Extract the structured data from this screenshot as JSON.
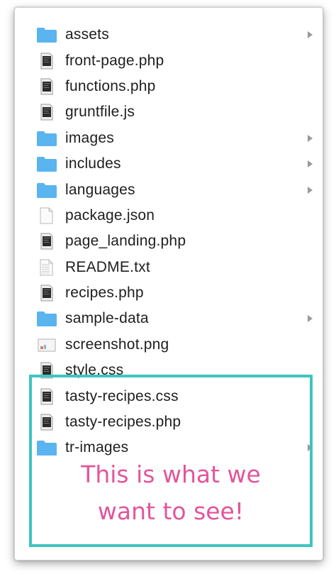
{
  "colors": {
    "folder": "#5ab4f0",
    "highlight_border": "#3ec5bf",
    "annotation_text": "#e2559b",
    "chevron": "#9a9a9a"
  },
  "files": [
    {
      "name": "assets",
      "icon": "folder-icon",
      "expandable": true
    },
    {
      "name": "front-page.php",
      "icon": "php-file-icon",
      "expandable": false
    },
    {
      "name": "functions.php",
      "icon": "php-file-icon",
      "expandable": false
    },
    {
      "name": "gruntfile.js",
      "icon": "js-file-icon",
      "expandable": false
    },
    {
      "name": "images",
      "icon": "folder-icon",
      "expandable": true
    },
    {
      "name": "includes",
      "icon": "folder-icon",
      "expandable": true
    },
    {
      "name": "languages",
      "icon": "folder-icon",
      "expandable": true
    },
    {
      "name": "package.json",
      "icon": "blank-file-icon",
      "expandable": false
    },
    {
      "name": "page_landing.php",
      "icon": "php-file-icon",
      "expandable": false
    },
    {
      "name": "README.txt",
      "icon": "text-file-icon",
      "expandable": false
    },
    {
      "name": "recipes.php",
      "icon": "php-file-icon",
      "expandable": false
    },
    {
      "name": "sample-data",
      "icon": "folder-icon",
      "expandable": true
    },
    {
      "name": "screenshot.png",
      "icon": "image-file-icon",
      "expandable": false
    },
    {
      "name": "style.css",
      "icon": "css-file-icon",
      "expandable": false
    },
    {
      "name": "tasty-recipes.css",
      "icon": "css-file-icon",
      "expandable": false
    },
    {
      "name": "tasty-recipes.php",
      "icon": "php-file-icon",
      "expandable": false
    },
    {
      "name": "tr-images",
      "icon": "folder-icon",
      "expandable": true
    }
  ],
  "annotation": {
    "line1": "This is what we",
    "line2": "want to see!"
  }
}
